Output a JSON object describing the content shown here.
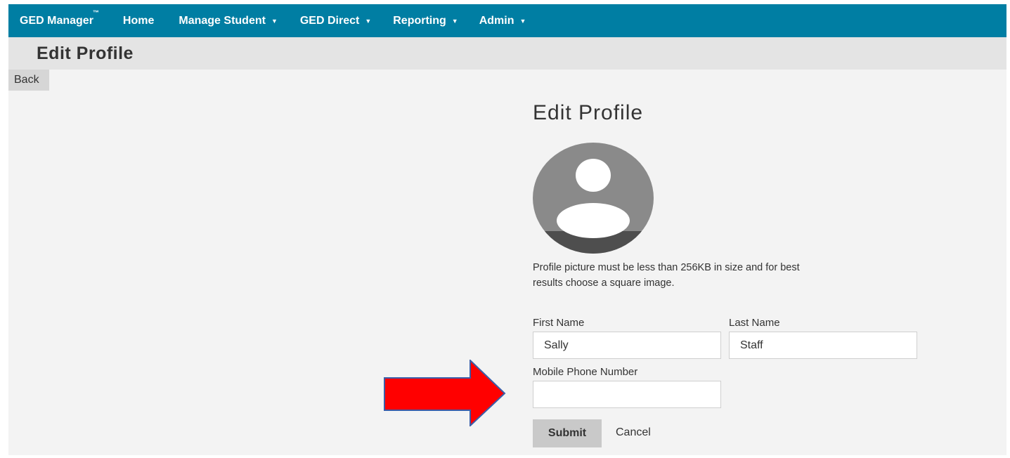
{
  "nav": {
    "brand": "GED Manager",
    "brand_mark": "™",
    "items": [
      {
        "label": "Home",
        "has_dropdown": false
      },
      {
        "label": "Manage Student",
        "has_dropdown": true
      },
      {
        "label": "GED Direct",
        "has_dropdown": true
      },
      {
        "label": "Reporting",
        "has_dropdown": true
      },
      {
        "label": "Admin",
        "has_dropdown": true
      }
    ],
    "caret": "▼"
  },
  "page_header": {
    "title": "Edit Profile"
  },
  "back_label": "Back",
  "form": {
    "title": "Edit Profile",
    "avatar_icon": "user-avatar-icon",
    "help_text": "Profile picture must be less than 256KB in size and for best results choose a square image.",
    "first_name": {
      "label": "First Name",
      "value": "Sally"
    },
    "last_name": {
      "label": "Last Name",
      "value": "Staff"
    },
    "mobile_phone": {
      "label": "Mobile Phone Number",
      "value": ""
    },
    "submit_label": "Submit",
    "cancel_label": "Cancel"
  },
  "annotation": {
    "icon": "red-arrow-icon",
    "color": "#ff0000",
    "outline": "#3b5da8"
  },
  "colors": {
    "navbar": "#007ea3",
    "header_band": "#e4e4e4",
    "page_bg": "#f3f3f3"
  }
}
